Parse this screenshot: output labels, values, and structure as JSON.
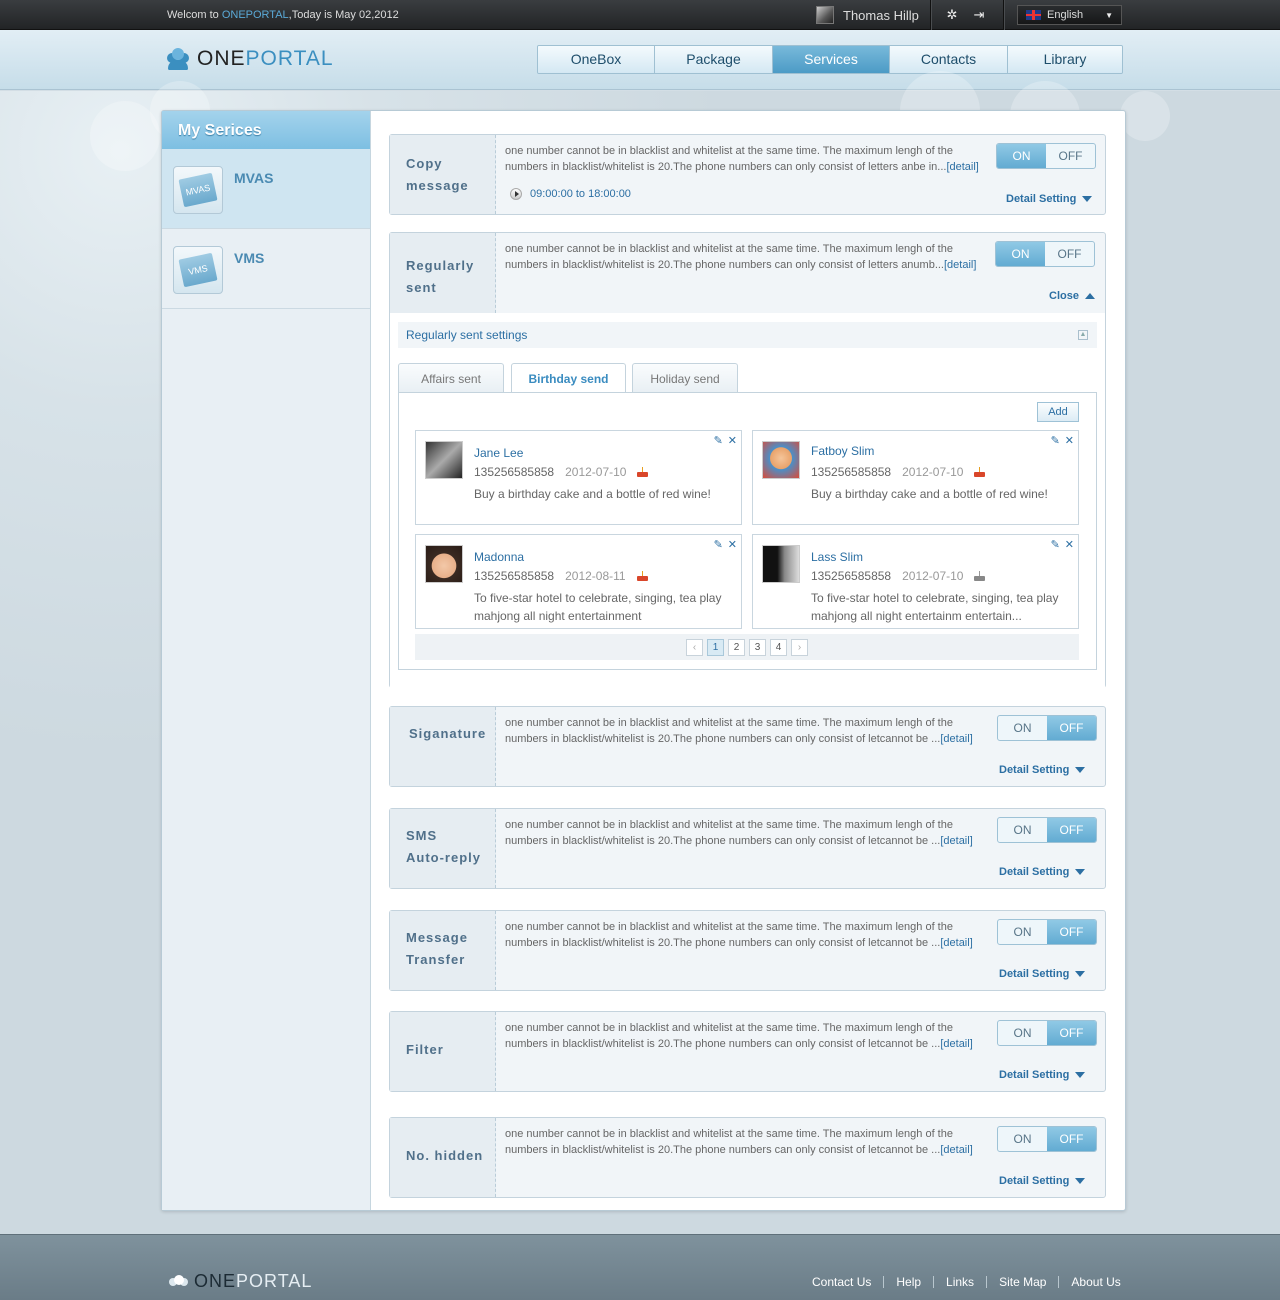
{
  "topbar": {
    "welcome_prefix": "Welcom to ",
    "welcome_brand": "ONEPORTAL",
    "welcome_suffix": ",Today is May 02,2012",
    "user_name": "Thomas Hillp",
    "language": "English",
    "icons": [
      "settings-icon",
      "logout-icon"
    ]
  },
  "header": {
    "logo_one": "ONE",
    "logo_portal": "PORTAL",
    "nav": [
      "OneBox",
      "Package",
      "Services",
      "Contacts",
      "Library"
    ],
    "nav_active": "Services"
  },
  "sidebar": {
    "title": "My Serices",
    "items": [
      {
        "label": "MVAS",
        "icon_text": "MVAS",
        "selected": true
      },
      {
        "label": "VMS",
        "icon_text": "VMS",
        "selected": false
      }
    ]
  },
  "labels": {
    "on": "ON",
    "off": "OFF",
    "detail_setting": "Detail Setting",
    "close": "Close",
    "detail_link": "[detail]"
  },
  "services": [
    {
      "title_1": "Copy",
      "title_2": "message",
      "desc": "one number cannot be in blacklist and whitelist at the same time. The maximum lengh of the numbers in blacklist/whitelist is 20.The phone numbers can only consist of letters anbe in...",
      "time": "09:00:00 to 18:00:00",
      "state": "ON"
    },
    {
      "title_1": "Regularly",
      "title_2": "sent",
      "desc": "one number cannot be in blacklist and whitelist at the same time. The maximum lengh of the numbers in blacklist/whitelist is 20.The phone numbers can only consist of letters anumb...",
      "state": "ON"
    },
    {
      "title_1": "Siganature",
      "title_2": "",
      "desc": "one number cannot be in blacklist and whitelist at the same time. The maximum lengh of the numbers in blacklist/whitelist is 20.The phone numbers can only consist of letcannot be ...",
      "state": "OFF"
    },
    {
      "title_1": "SMS",
      "title_2": "Auto-reply",
      "desc": "one number cannot be in blacklist and whitelist at the same time. The maximum lengh of the numbers in blacklist/whitelist is 20.The phone numbers can only consist of letcannot be ...",
      "state": "OFF"
    },
    {
      "title_1": "Message",
      "title_2": "Transfer",
      "desc": "one number cannot be in blacklist and whitelist at the same time. The maximum lengh of the numbers in blacklist/whitelist is 20.The phone numbers can only consist of letcannot be ...",
      "state": "OFF"
    },
    {
      "title_1": "Filter",
      "title_2": "",
      "desc": "one number cannot be in blacklist and whitelist at the same time. The maximum lengh of the numbers in blacklist/whitelist is 20.The phone numbers can only consist of letcannot be ...",
      "state": "OFF"
    },
    {
      "title_1": "No. hidden",
      "title_2": "",
      "desc": "one number cannot be in blacklist and whitelist at the same time. The maximum lengh of the numbers in blacklist/whitelist is 20.The phone numbers can only consist of letcannot be ...",
      "state": "OFF"
    }
  ],
  "regular_settings": {
    "title": "Regularly sent settings",
    "tabs": [
      "Affairs sent",
      "Birthday send",
      "Holiday send"
    ],
    "active_tab": "Birthday send",
    "add_label": "Add",
    "cards": [
      {
        "name": "Jane Lee",
        "phone": "135256585858",
        "date": "2012-07-10",
        "message": "Buy a birthday cake and a bottle of red wine!"
      },
      {
        "name": "Fatboy Slim",
        "phone": "135256585858",
        "date": "2012-07-10",
        "message": "Buy a birthday cake and a bottle of red wine!"
      },
      {
        "name": "Madonna",
        "phone": "135256585858",
        "date": "2012-08-11",
        "message": "To five-star hotel to celebrate, singing, tea play mahjong all night entertainment"
      },
      {
        "name": "Lass Slim",
        "phone": "135256585858",
        "date": "2012-07-10",
        "message": "To five-star hotel to celebrate, singing, tea play mahjong all night entertainm    entertain..."
      }
    ],
    "pages": [
      "1",
      "2",
      "3",
      "4"
    ],
    "current_page": "1"
  },
  "footer": {
    "logo_one": "ONE",
    "logo_portal": "PORTAL",
    "links": [
      "Contact Us",
      "Help",
      "Links",
      "Site Map",
      "About Us"
    ]
  }
}
